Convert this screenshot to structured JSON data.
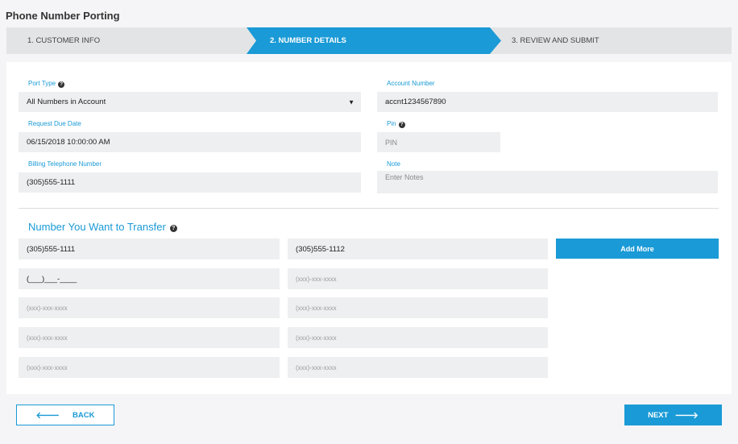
{
  "page": {
    "title": "Phone Number Porting"
  },
  "stepper": {
    "steps": [
      {
        "label": "1. CUSTOMER INFO",
        "active": false
      },
      {
        "label": "2. NUMBER DETAILS",
        "active": true
      },
      {
        "label": "3. REVIEW AND SUBMIT",
        "active": false
      }
    ]
  },
  "form": {
    "port_type": {
      "label": "Port Type",
      "value": "All Numbers in Account",
      "help_icon": "question-circle-icon"
    },
    "account_number": {
      "label": "Account Number",
      "value": "accnt1234567890"
    },
    "request_due_date": {
      "label": "Request Due Date",
      "value": "06/15/2018 10:00:00 AM"
    },
    "pin": {
      "label": "Pin",
      "placeholder": "PIN",
      "help_icon": "question-circle-icon"
    },
    "billing_telephone": {
      "label": "Billing Telephone Number",
      "value": "(305)555-1111"
    },
    "note": {
      "label": "Note",
      "placeholder": "Enter Notes"
    }
  },
  "transfer": {
    "title": "Number You Want to Transfer",
    "add_more_label": "Add More",
    "placeholder": "(xxx)-xxx-xxxx",
    "numbers": [
      "(305)555-1111",
      "(305)555-1112",
      "(___)___-____",
      "",
      "",
      "",
      "",
      "",
      "",
      ""
    ]
  },
  "footer": {
    "back_label": "BACK",
    "next_label": "NEXT"
  },
  "colors": {
    "accent": "#1a9ad6",
    "field_bg": "#eeeff1",
    "stepper_bg": "#e3e4e6"
  }
}
